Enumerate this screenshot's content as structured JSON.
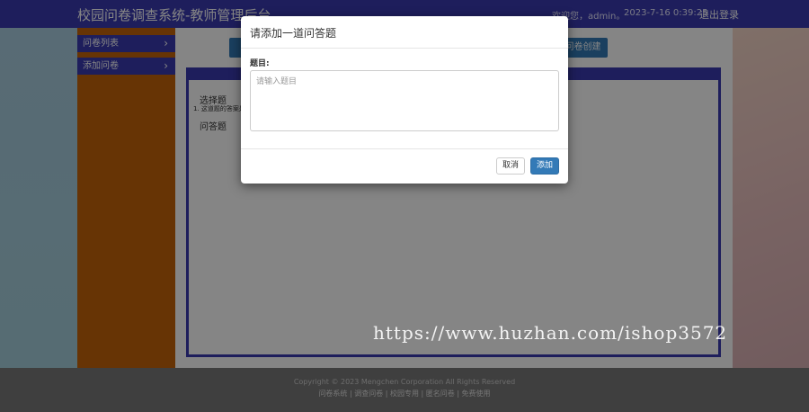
{
  "header": {
    "title": "校园问卷调查系统-教师管理后台",
    "greeting": "欢迎您，admin。",
    "datetime": "2023-7-16 0:39:25",
    "logout": "退出登录"
  },
  "sidebar": {
    "items": [
      {
        "label": "问卷列表",
        "icon": "chevron-right-icon"
      },
      {
        "label": "添加问卷",
        "icon": "chevron-right-icon"
      }
    ]
  },
  "main": {
    "right_button": "问卷创建",
    "question_types": [
      "选择题",
      "问答题"
    ],
    "subtext": "1. 这道题的答案是"
  },
  "modal": {
    "title": "请添加一道问答题",
    "field_label": "题目:",
    "placeholder": "请输入题目",
    "cancel": "取消",
    "add": "添加"
  },
  "footer": {
    "copyright": "Copyright © 2023 Mengchen Corporation All Rights Reserved",
    "links": "问卷系统 | 调查问卷 | 校园专用 | 匿名问卷 | 免费使用"
  },
  "watermark": "https://www.huzhan.com/ishop3572",
  "colors": {
    "header": "#3b3bb0",
    "sidebar": "#c6640b",
    "primary_button": "#337ab7",
    "footer": "#7a7a7a"
  }
}
